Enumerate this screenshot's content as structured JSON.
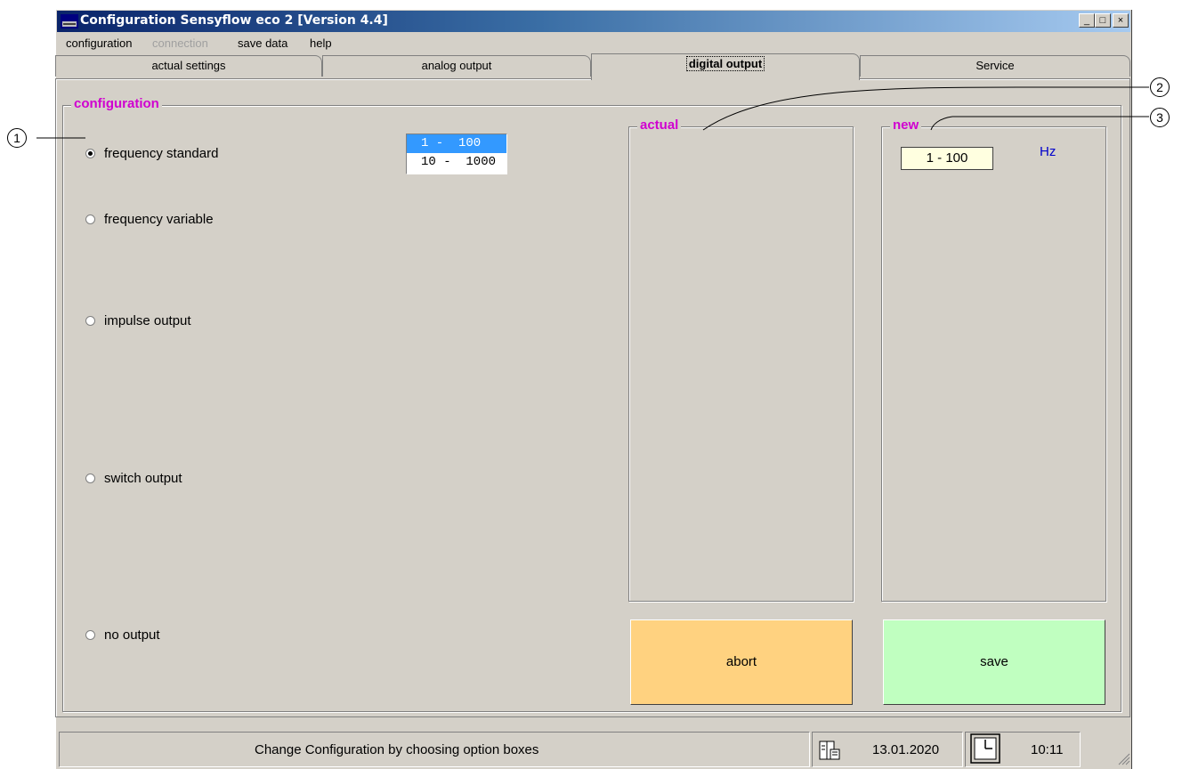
{
  "window": {
    "title": "Configuration Sensyflow eco 2 [Version 4.4]",
    "minimize": "_",
    "maximize": "□",
    "close": "×"
  },
  "menu": [
    {
      "label": "configuration",
      "enabled": true
    },
    {
      "label": "connection",
      "enabled": false
    },
    {
      "label": "save data",
      "enabled": true
    },
    {
      "label": "help",
      "enabled": true
    }
  ],
  "tabs": [
    {
      "label": "actual settings",
      "active": false
    },
    {
      "label": "analog output",
      "active": false
    },
    {
      "label": "digital output",
      "active": true
    },
    {
      "label": "Service",
      "active": false
    }
  ],
  "configuration": {
    "legend": "configuration",
    "options": [
      {
        "label": "frequency standard",
        "selected": true
      },
      {
        "label": "frequency variable",
        "selected": false
      },
      {
        "label": "impulse output",
        "selected": false
      },
      {
        "label": "switch output",
        "selected": false
      },
      {
        "label": "no output",
        "selected": false
      }
    ],
    "range_list": {
      "items": [
        "1 -  100",
        "10 -  1000"
      ],
      "selected_index": 0
    }
  },
  "actual": {
    "legend": "actual"
  },
  "new": {
    "legend": "new",
    "value": "1 - 100",
    "unit": "Hz"
  },
  "buttons": {
    "abort": "abort",
    "save": "save",
    "abort_color": "#ffd280",
    "save_color": "#c0ffc0"
  },
  "callouts": [
    "1",
    "2",
    "3"
  ],
  "status": {
    "message": "Change Configuration by choosing option boxes",
    "date": "13.01.2020",
    "time": "10:11"
  },
  "colors": {
    "legend": "#d000d0",
    "face": "#d4d0c8",
    "unit": "#0000cc"
  }
}
